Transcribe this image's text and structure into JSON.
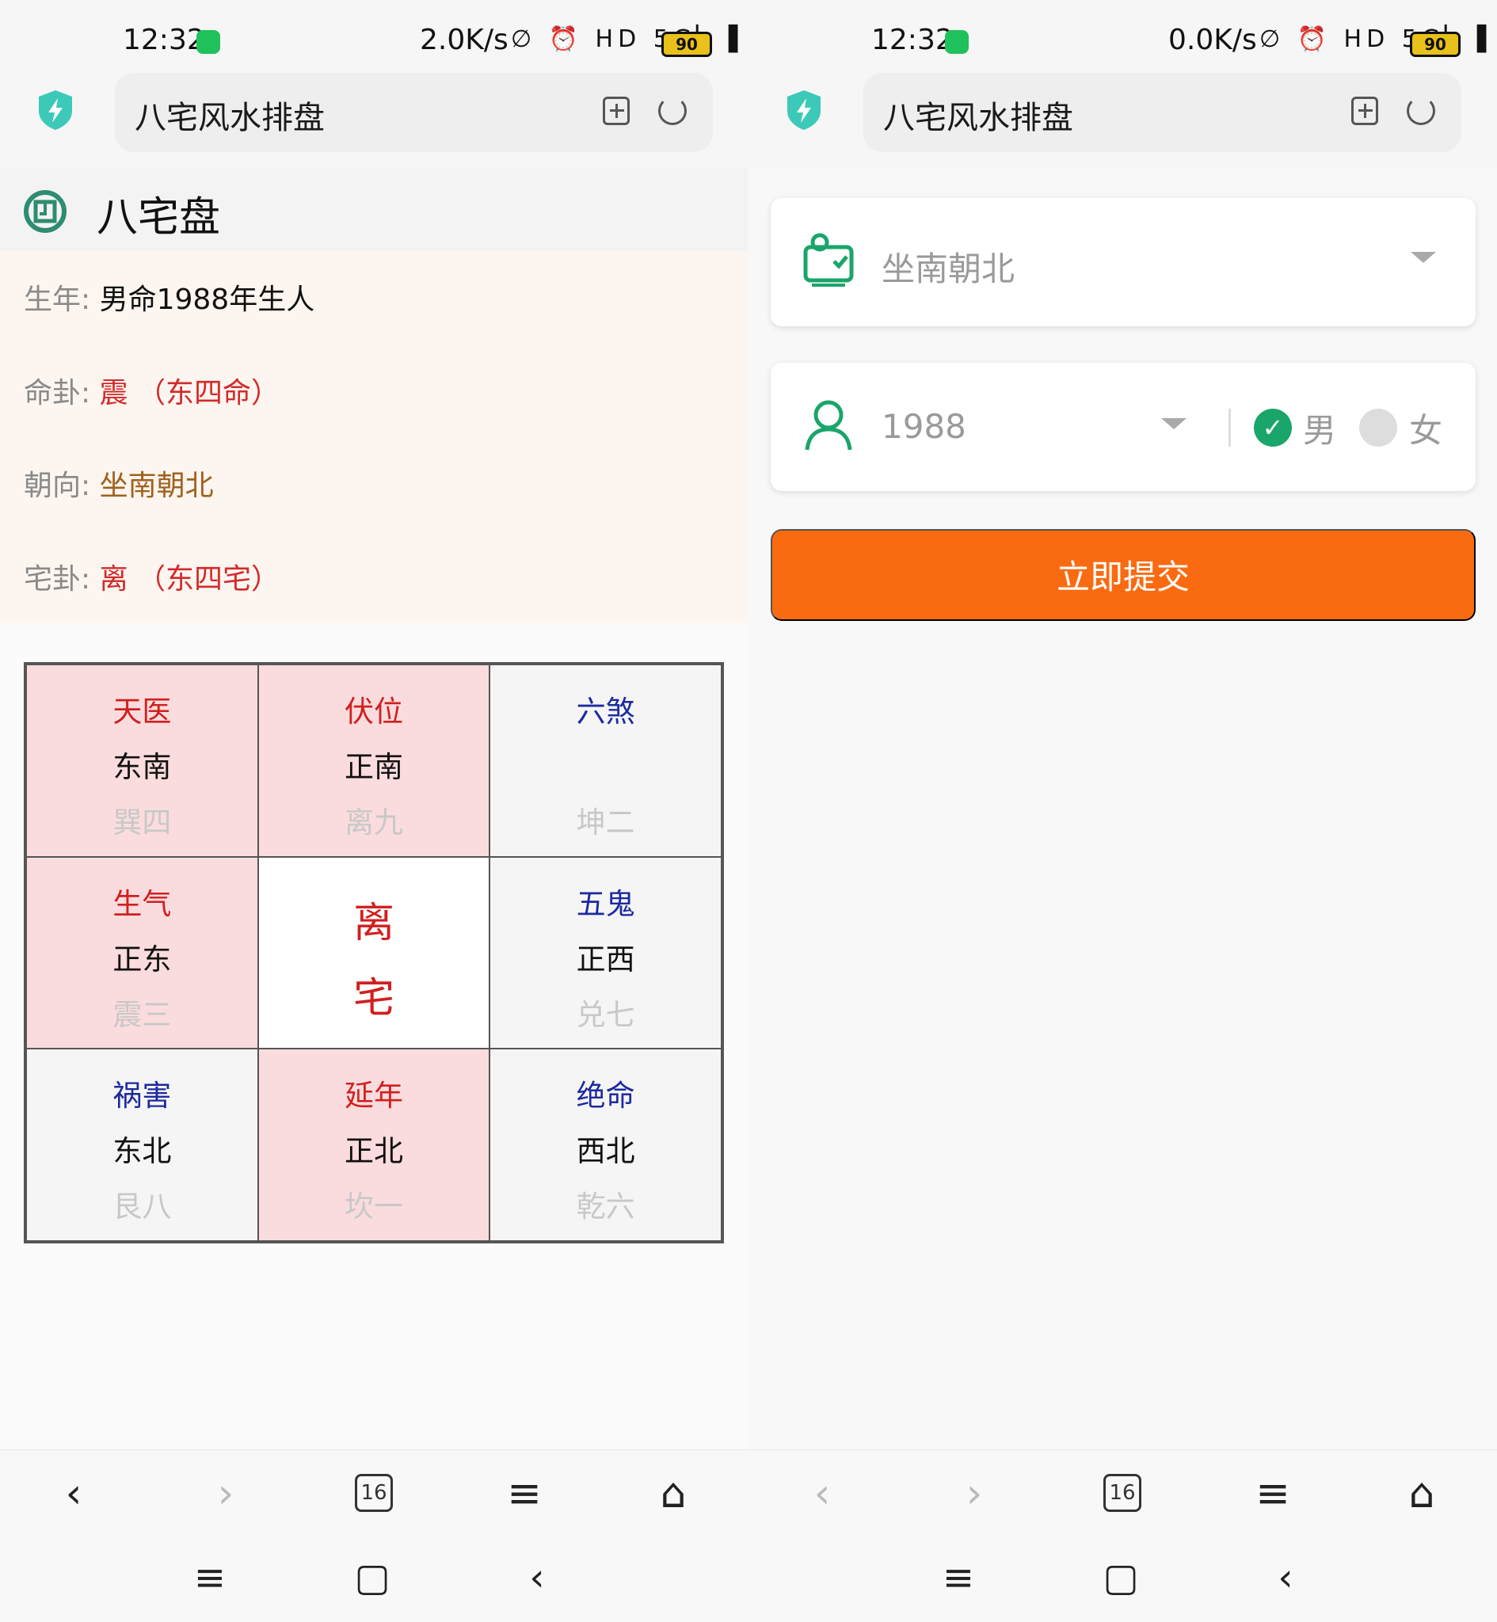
{
  "left": {
    "status": {
      "time": "12:32",
      "speed": "2.0K/s",
      "icons": "∅ ⏰ HD 5G▏▐",
      "battery": "90"
    },
    "browser": {
      "title": "八宅风水排盘"
    },
    "page": {
      "title": "八宅盘",
      "info": [
        {
          "label": "生年:",
          "value": "男命1988年生人",
          "tone": "black"
        },
        {
          "label": "命卦:",
          "value": "震 （东四命）",
          "tone": "red"
        },
        {
          "label": "朝向:",
          "value": "坐南朝北",
          "tone": "brown"
        },
        {
          "label": "宅卦:",
          "value": "离 （东四宅）",
          "tone": "red"
        }
      ],
      "grid": [
        {
          "star": "天医",
          "dir": "东南",
          "gua": "巽四",
          "tone": "red",
          "bg": "pink"
        },
        {
          "star": "伏位",
          "dir": "正南",
          "gua": "离九",
          "tone": "red",
          "bg": "pink"
        },
        {
          "star": "六煞",
          "dir": "",
          "gua": "坤二",
          "tone": "blue",
          "bg": "gray"
        },
        {
          "star": "生气",
          "dir": "正东",
          "gua": "震三",
          "tone": "red",
          "bg": "pink"
        },
        {
          "center_1": "离",
          "center_2": "宅",
          "bg": "white"
        },
        {
          "star": "五鬼",
          "dir": "正西",
          "gua": "兑七",
          "tone": "blue",
          "bg": "gray"
        },
        {
          "star": "祸害",
          "dir": "东北",
          "gua": "艮八",
          "tone": "blue",
          "bg": "gray"
        },
        {
          "star": "延年",
          "dir": "正北",
          "gua": "坎一",
          "tone": "red",
          "bg": "pink"
        },
        {
          "star": "绝命",
          "dir": "西北",
          "gua": "乾六",
          "tone": "blue",
          "bg": "gray"
        }
      ]
    },
    "nav": {
      "tabs": "16"
    }
  },
  "right": {
    "status": {
      "time": "12:32",
      "speed": "0.0K/s",
      "icons": "∅ ⏰ HD 5G▏▐",
      "battery": "90"
    },
    "browser": {
      "title": "八宅风水排盘"
    },
    "form": {
      "orientation_value": "坐南朝北",
      "year_value": "1988",
      "gender_male": "男",
      "gender_female": "女",
      "selected_gender": "男",
      "submit_label": "立即提交"
    },
    "nav": {
      "tabs": "16"
    }
  },
  "colors": {
    "accent_green": "#1aa56a",
    "submit_orange": "#fa6b11",
    "red_text": "#d11f1f",
    "blue_text": "#1d2a9e",
    "pink_cell": "#fbdcde"
  },
  "icons": {
    "wechat": "wechat-icon",
    "shield": "shield-icon",
    "add_bookmark": "add-bookmark-icon",
    "reload": "reload-icon",
    "back": "back-icon",
    "forward": "forward-icon",
    "tabs": "tabs-icon",
    "menu": "menu-icon",
    "home": "home-icon"
  }
}
